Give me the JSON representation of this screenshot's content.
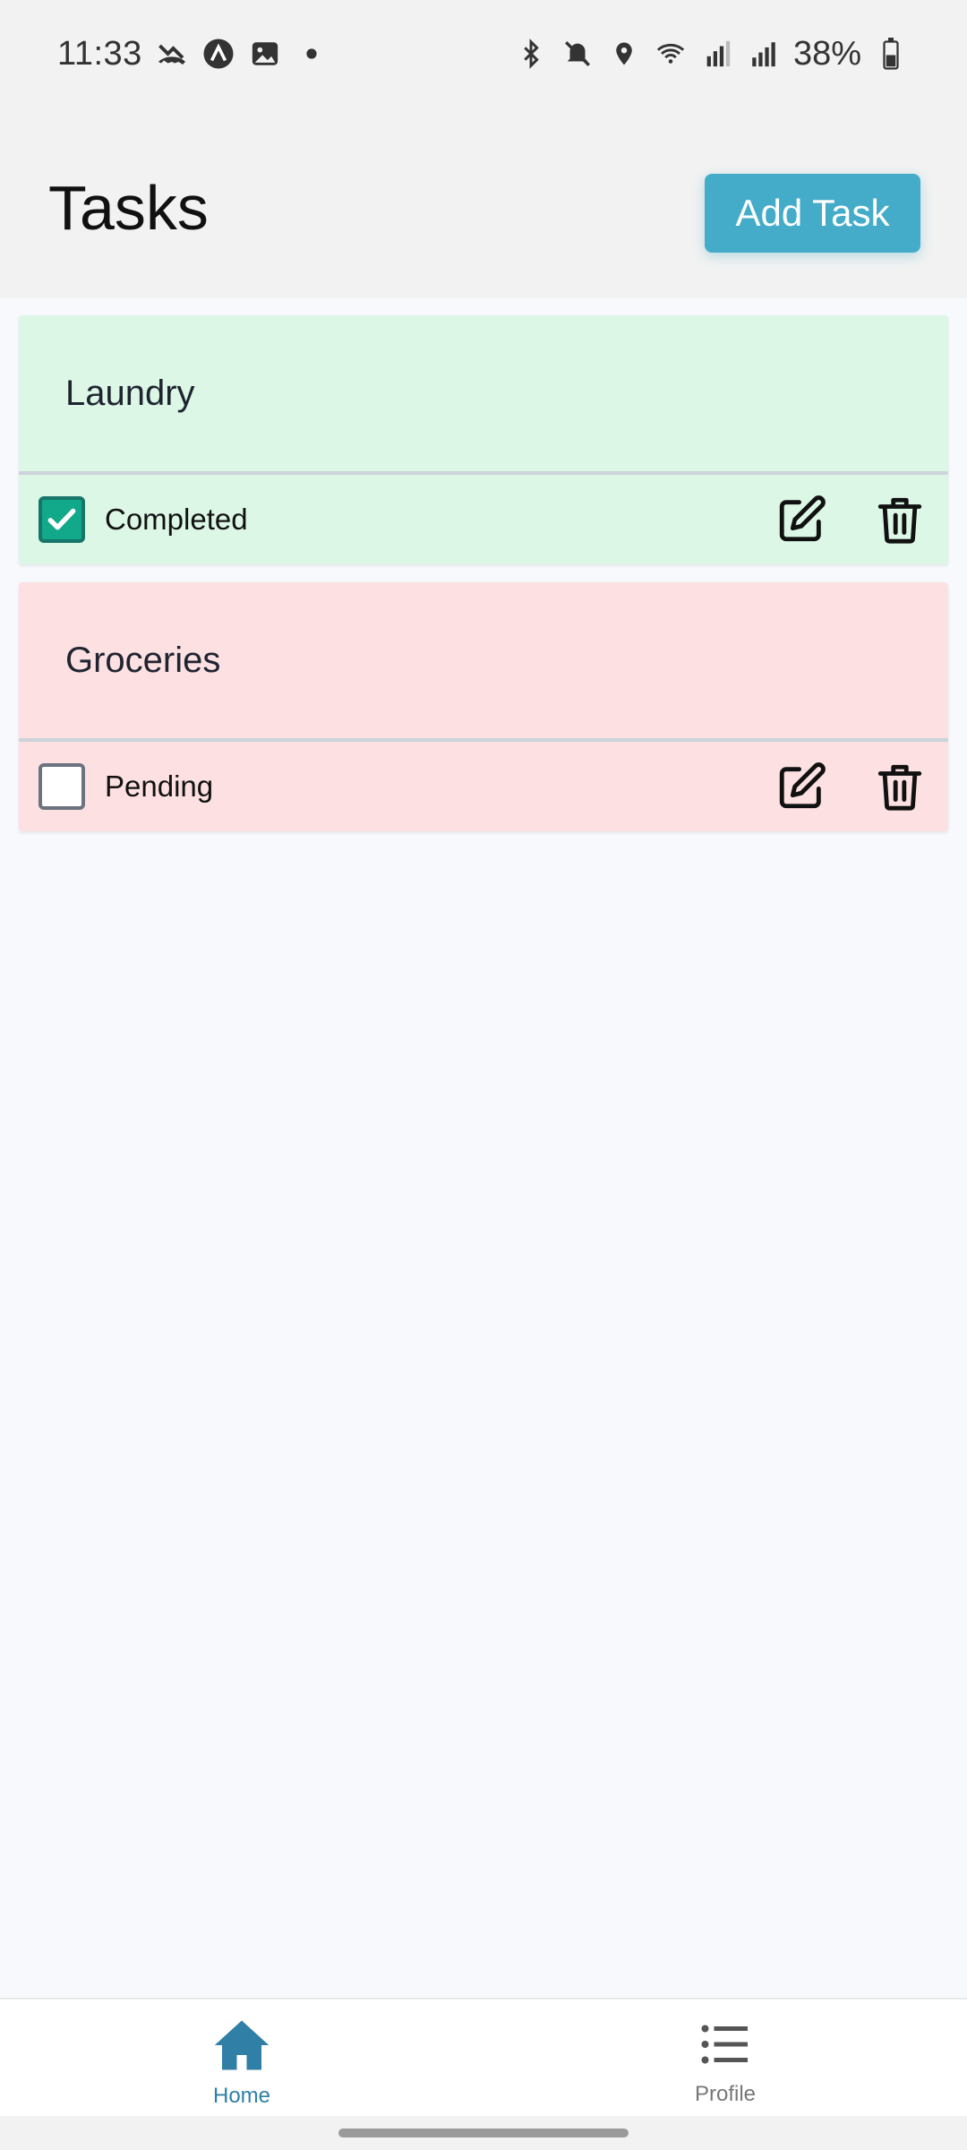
{
  "status_bar": {
    "time": "11:33",
    "battery": "38%",
    "icons": [
      "missed-call-icon",
      "app-a-icon",
      "gallery-icon",
      "dot-icon",
      "bluetooth-icon",
      "mute-icon",
      "location-icon",
      "wifi-icon",
      "signal-r-icon",
      "signal-icon",
      "battery-icon"
    ]
  },
  "header": {
    "title": "Tasks",
    "add_button": "Add Task",
    "accent": "#44acc9"
  },
  "tasks": [
    {
      "title": "Laundry",
      "status": "Completed",
      "checked": true,
      "bg": "#dcf7e6"
    },
    {
      "title": "Groceries",
      "status": "Pending",
      "checked": false,
      "bg": "#fde0e1"
    }
  ],
  "nav": {
    "items": [
      {
        "label": "Home",
        "icon": "home-icon",
        "active": true
      },
      {
        "label": "Profile",
        "icon": "list-icon",
        "active": false
      }
    ]
  }
}
